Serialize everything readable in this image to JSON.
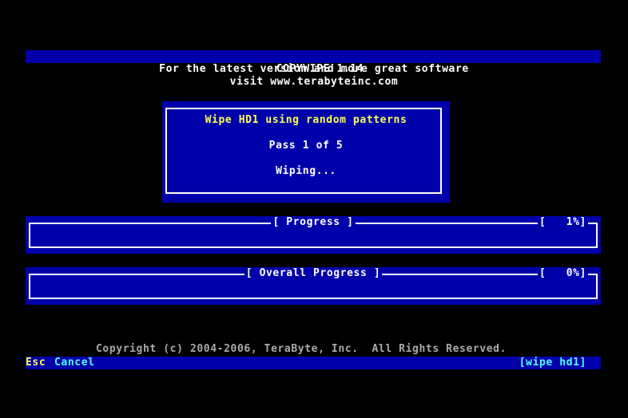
{
  "header": {
    "title": "COPYWIPE 1.14",
    "tagline_line1": "For the latest version and more great software",
    "tagline_line2": "visit www.terabyteinc.com"
  },
  "dialog": {
    "title": "Wipe HD1 using random patterns",
    "pass_text": "Pass 1 of 5",
    "status_text": "Wiping..."
  },
  "progress": {
    "label": "[ Progress ]",
    "percent_text": "[   1%]",
    "percent_value": 1
  },
  "overall_progress": {
    "label": "[ Overall Progress ]",
    "percent_text": "[   0%]",
    "percent_value": 0
  },
  "footer": {
    "copyright": "Copyright (c) 2004-2006, TeraByte, Inc.  All Rights Reserved."
  },
  "status_bar": {
    "key": "Esc",
    "key_action": "Cancel",
    "context": "[wipe hd1]"
  },
  "colors": {
    "background": "#000000",
    "panel_blue": "#0000aa",
    "highlight_yellow": "#ffff55",
    "accent_cyan": "#55ffff",
    "text_white": "#ffffff",
    "text_gray": "#aaaaaa"
  }
}
